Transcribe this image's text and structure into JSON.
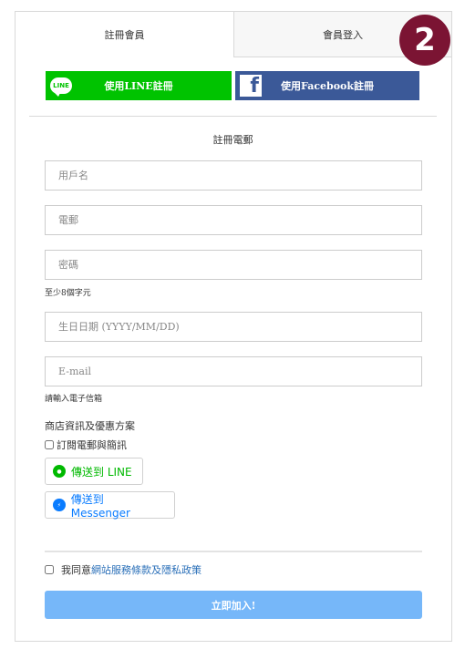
{
  "tabs": {
    "register": "註冊會員",
    "login": "會員登入"
  },
  "badge": "2",
  "social": {
    "line_label": "使用LINE註冊",
    "line_icon_text": "LINE",
    "facebook_label": "使用Facebook註冊",
    "facebook_icon_text": "f"
  },
  "form": {
    "section_title": "註冊電郵",
    "username_placeholder": "用戶名",
    "email_placeholder": "電郵",
    "password_placeholder": "密碼",
    "password_hint": "至少8個字元",
    "birthday_placeholder": "生日日期 (YYYY/MM/DD)",
    "email2_placeholder": "E-mail",
    "email2_hint": "請輸入電子信箱"
  },
  "promo": {
    "title": "商店資訊及優惠方案",
    "subscribe_label": "訂閱電郵與簡訊",
    "send_line_label": "傳送到 LINE",
    "send_messenger_label": "傳送到 Messenger"
  },
  "agree": {
    "prefix": "我同意",
    "link_text": "網站服務條款及隱私政策"
  },
  "submit_label": "立即加入!",
  "colors": {
    "line_green": "#00c300",
    "facebook_blue": "#3b5998",
    "badge": "#7b1433",
    "submit": "#76b7f9",
    "link": "#2a6fb8"
  }
}
